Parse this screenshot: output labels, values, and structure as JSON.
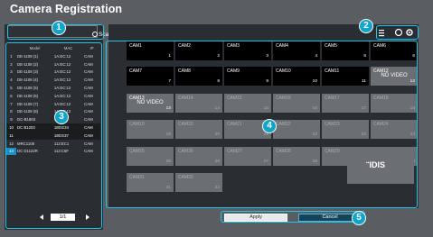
{
  "title": "Camera Registration",
  "scan_label": "Scan",
  "columns": [
    "Model",
    "MAC",
    "IP"
  ],
  "devices": [
    {
      "no": "1",
      "model": "DE-1108 (1)",
      "mac": "1A:EC:12",
      "ip": "CAM"
    },
    {
      "no": "2",
      "model": "DE-1108 (2)",
      "mac": "1A:EC:12",
      "ip": "CAM"
    },
    {
      "no": "3",
      "model": "DE-1108 (3)",
      "mac": "1A:EC:12",
      "ip": "CAM"
    },
    {
      "no": "4",
      "model": "DE-1108 (4)",
      "mac": "1A:EC:12",
      "ip": "CAM"
    },
    {
      "no": "5",
      "model": "DE-1108 (5)",
      "mac": "1A:EC:12",
      "ip": "CAM"
    },
    {
      "no": "6",
      "model": "DE-1108 (6)",
      "mac": "1A:EC:12",
      "ip": "CAM"
    },
    {
      "no": "7",
      "model": "DE-1108 (7)",
      "mac": "1A:EC:12",
      "ip": "CAM"
    },
    {
      "no": "8",
      "model": "DE-1108 (8)",
      "mac": "1A:EC:12",
      "ip": "CAM"
    },
    {
      "no": "9",
      "model": "DC-B1803",
      "mac": "1A:EC",
      "ip": "CAM"
    },
    {
      "no": "10",
      "model": "DC B1203",
      "mac": "180:E34",
      "ip": "CAM"
    },
    {
      "no": "11",
      "model": "",
      "mac": "180:E37",
      "ip": "CAM"
    },
    {
      "no": "12",
      "model": "MRC1108",
      "mac": "112:EC1",
      "ip": "CAM"
    },
    {
      "no": "13",
      "model": "DC D1122R",
      "mac": "112:C6F",
      "ip": "CAM"
    }
  ],
  "pager": {
    "text": "1/1"
  },
  "cameras": [
    {
      "name": "CAM1",
      "num": "1",
      "style": "black",
      "nv": ""
    },
    {
      "name": "CAM2",
      "num": "2",
      "style": "black",
      "nv": ""
    },
    {
      "name": "CAM3",
      "num": "3",
      "style": "black",
      "nv": ""
    },
    {
      "name": "CAM4",
      "num": "4",
      "style": "black",
      "nv": ""
    },
    {
      "name": "CAM5",
      "num": "5",
      "style": "black",
      "nv": ""
    },
    {
      "name": "CAM6",
      "num": "6",
      "style": "black",
      "nv": ""
    },
    {
      "name": "CAM7",
      "num": "7",
      "style": "black",
      "nv": ""
    },
    {
      "name": "CAM8",
      "num": "8",
      "style": "black",
      "nv": ""
    },
    {
      "name": "CAM9",
      "num": "9",
      "style": "black",
      "nv": ""
    },
    {
      "name": "CAM10",
      "num": "10",
      "style": "black",
      "nv": ""
    },
    {
      "name": "CAM11",
      "num": "11",
      "style": "black",
      "nv": ""
    },
    {
      "name": "CAM12",
      "num": "12",
      "style": "gn",
      "nv": "NO VIDEO"
    },
    {
      "name": "CAM13",
      "num": "13",
      "style": "gn",
      "nv": "NO VIDEO"
    },
    {
      "name": "CAM14",
      "num": "14",
      "style": "grey",
      "nv": ""
    },
    {
      "name": "CAM15",
      "num": "15",
      "style": "grey",
      "nv": ""
    },
    {
      "name": "CAM16",
      "num": "16",
      "style": "grey",
      "nv": ""
    },
    {
      "name": "CAM17",
      "num": "17",
      "style": "grey",
      "nv": ""
    },
    {
      "name": "CAM18",
      "num": "18",
      "style": "grey",
      "nv": ""
    },
    {
      "name": "CAM19",
      "num": "19",
      "style": "grey",
      "nv": ""
    },
    {
      "name": "CAM20",
      "num": "20",
      "style": "grey",
      "nv": ""
    },
    {
      "name": "CAM21",
      "num": "21",
      "style": "grey",
      "nv": ""
    },
    {
      "name": "CAM22",
      "num": "22",
      "style": "grey",
      "nv": ""
    },
    {
      "name": "CAM23",
      "num": "23",
      "style": "grey",
      "nv": ""
    },
    {
      "name": "CAM24",
      "num": "24",
      "style": "grey",
      "nv": ""
    },
    {
      "name": "CAM25",
      "num": "25",
      "style": "grey",
      "nv": ""
    },
    {
      "name": "CAM26",
      "num": "26",
      "style": "grey",
      "nv": ""
    },
    {
      "name": "CAM27",
      "num": "27",
      "style": "grey",
      "nv": ""
    },
    {
      "name": "CAM28",
      "num": "28",
      "style": "grey",
      "nv": ""
    },
    {
      "name": "CAM29",
      "num": "29",
      "style": "grey",
      "nv": ""
    },
    {
      "name": "CAM30",
      "num": "30",
      "style": "grey",
      "nv": ""
    },
    {
      "name": "CAM31",
      "num": "31",
      "style": "grey",
      "nv": ""
    },
    {
      "name": "CAM32",
      "num": "32",
      "style": "grey",
      "nv": ""
    }
  ],
  "logo": "IDIS",
  "apply_label": "Apply",
  "cancel_label": "Cancel",
  "callouts": [
    "1",
    "2",
    "3",
    "4",
    "5"
  ],
  "colors": {
    "accent": "#24c2e6",
    "badge": "#10a4c8",
    "cancel_bg": "#15435c"
  }
}
